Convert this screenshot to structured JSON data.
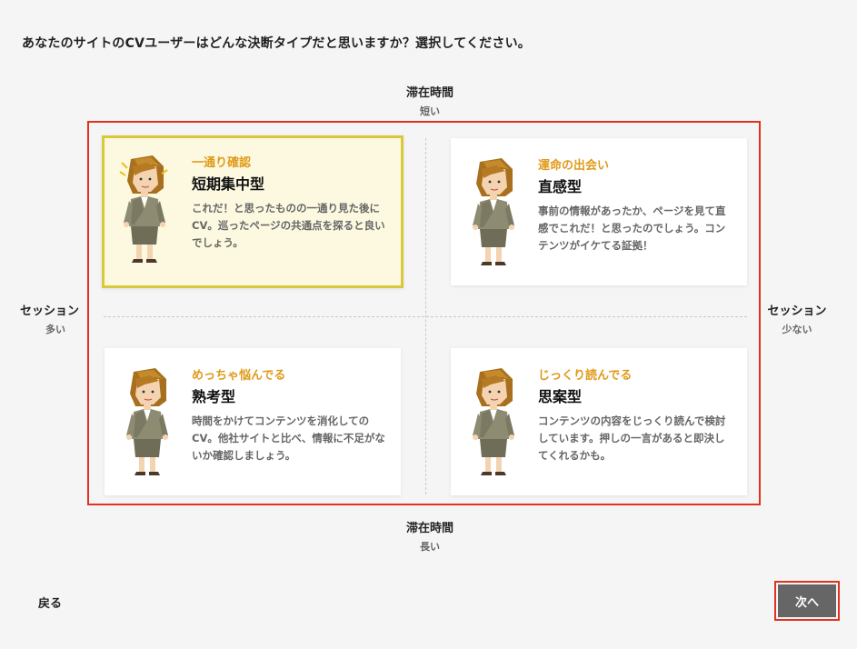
{
  "question": "あなたのサイトのCVユーザーはどんな決断タイプだと思いますか？選択してください。",
  "axes": {
    "top": {
      "title": "滞在時間",
      "sub": "短い"
    },
    "bottom": {
      "title": "滞在時間",
      "sub": "長い"
    },
    "left": {
      "title": "セッション",
      "sub": "多い"
    },
    "right": {
      "title": "セッション",
      "sub": "少ない"
    }
  },
  "cards": [
    {
      "tag": "一通り確認",
      "type": "短期集中型",
      "desc": "これだ！と思ったものの一通り見た後にCV。巡ったページの共通点を探ると良いでしょう。",
      "selected": true,
      "figure_icon": "businesswoman-thinking-icon"
    },
    {
      "tag": "運命の出会い",
      "type": "直感型",
      "desc": "事前の情報があったか、ページを見て直感でこれだ！と思ったのでしょう。コンテンツがイケてる証拠！",
      "selected": false,
      "figure_icon": "businesswoman-presenting-icon"
    },
    {
      "tag": "めっちゃ悩んでる",
      "type": "熟考型",
      "desc": "時間をかけてコンテンツを消化してのCV。他社サイトと比べ、情報に不足がないか確認しましょう。",
      "selected": false,
      "figure_icon": "businesswoman-arms-crossed-icon"
    },
    {
      "tag": "じっくり読んでる",
      "type": "思案型",
      "desc": "コンテンツの内容をじっくり読んで検討しています。押しの一言があると即決してくれるかも。",
      "selected": false,
      "figure_icon": "businesswoman-pondering-icon"
    }
  ],
  "footer": {
    "back_label": "戻る",
    "next_label": "次へ"
  },
  "colors": {
    "accent": "#e09a1a",
    "selected_bg": "#fcf9e0",
    "selected_border": "#d9c83c",
    "highlight_frame": "#e0321e",
    "next_button": "#666666"
  }
}
